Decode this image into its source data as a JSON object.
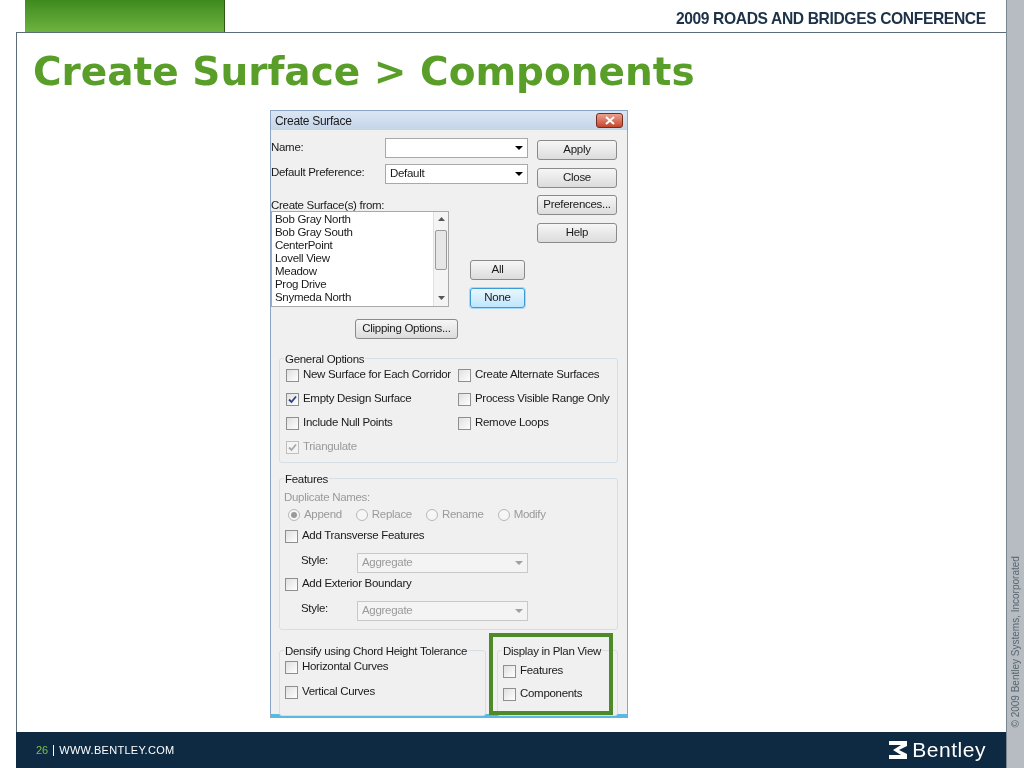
{
  "header": {
    "conference": "2009 ROADS AND BRIDGES CONFERENCE"
  },
  "title": "Create Surface > Components",
  "dialog": {
    "title": "Create Surface",
    "name": {
      "label": "Name:"
    },
    "default_preference": {
      "label": "Default Preference:",
      "value": "Default"
    },
    "buttons": [
      "Apply",
      "Close",
      "Preferences...",
      "Help"
    ],
    "source": {
      "label": "Create Surface(s) from:",
      "items": [
        "Bob Gray North",
        "Bob Gray South",
        "CenterPoint",
        "Lovell View",
        "Meadow",
        "Prog Drive",
        "Snymeda North"
      ]
    },
    "list_buttons": [
      {
        "label": "All",
        "focused": false
      },
      {
        "label": "None",
        "focused": true
      }
    ],
    "clipping_button": "Clipping Options...",
    "general_options": {
      "title": "General Options",
      "options": [
        {
          "label": "New Surface for Each Corridor",
          "checked": false,
          "disabled": false
        },
        {
          "label": "Create Alternate Surfaces",
          "checked": false,
          "disabled": false
        },
        {
          "label": "Empty Design Surface",
          "checked": true,
          "disabled": false
        },
        {
          "label": "Process Visible Range Only",
          "checked": false,
          "disabled": false
        },
        {
          "label": "Include Null Points",
          "checked": false,
          "disabled": false
        },
        {
          "label": "Remove Loops",
          "checked": false,
          "disabled": false
        },
        {
          "label": "Triangulate",
          "checked": true,
          "disabled": true
        }
      ]
    },
    "features": {
      "title": "Features",
      "duplicate_names": {
        "label": "Duplicate Names:",
        "disabled": true,
        "options": [
          {
            "label": "Append",
            "selected": true
          },
          {
            "label": "Replace",
            "selected": false
          },
          {
            "label": "Rename",
            "selected": false
          },
          {
            "label": "Modify",
            "selected": false
          }
        ]
      },
      "rows": [
        {
          "kind": "checkbox",
          "label": "Add Transverse Features",
          "checked": false
        },
        {
          "kind": "style",
          "label": "Style:",
          "value": "Aggregate",
          "disabled": true
        },
        {
          "kind": "checkbox",
          "label": "Add Exterior Boundary",
          "checked": false
        },
        {
          "kind": "style",
          "label": "Style:",
          "value": "Aggregate",
          "disabled": true
        }
      ]
    },
    "densify": {
      "title": "Densify using Chord Height Tolerance",
      "options": [
        {
          "label": "Horizontal Curves",
          "checked": false
        },
        {
          "label": "Vertical Curves",
          "checked": false
        }
      ]
    },
    "display": {
      "title": "Display in Plan View",
      "highlighted": true,
      "options": [
        {
          "label": "Features",
          "checked": false
        },
        {
          "label": "Components",
          "checked": false
        }
      ]
    }
  },
  "footer": {
    "page": "26",
    "url": "WWW.BENTLEY.COM",
    "logo": "Bentley"
  },
  "copyright": "© 2009 Bentley Systems, Incorporated"
}
